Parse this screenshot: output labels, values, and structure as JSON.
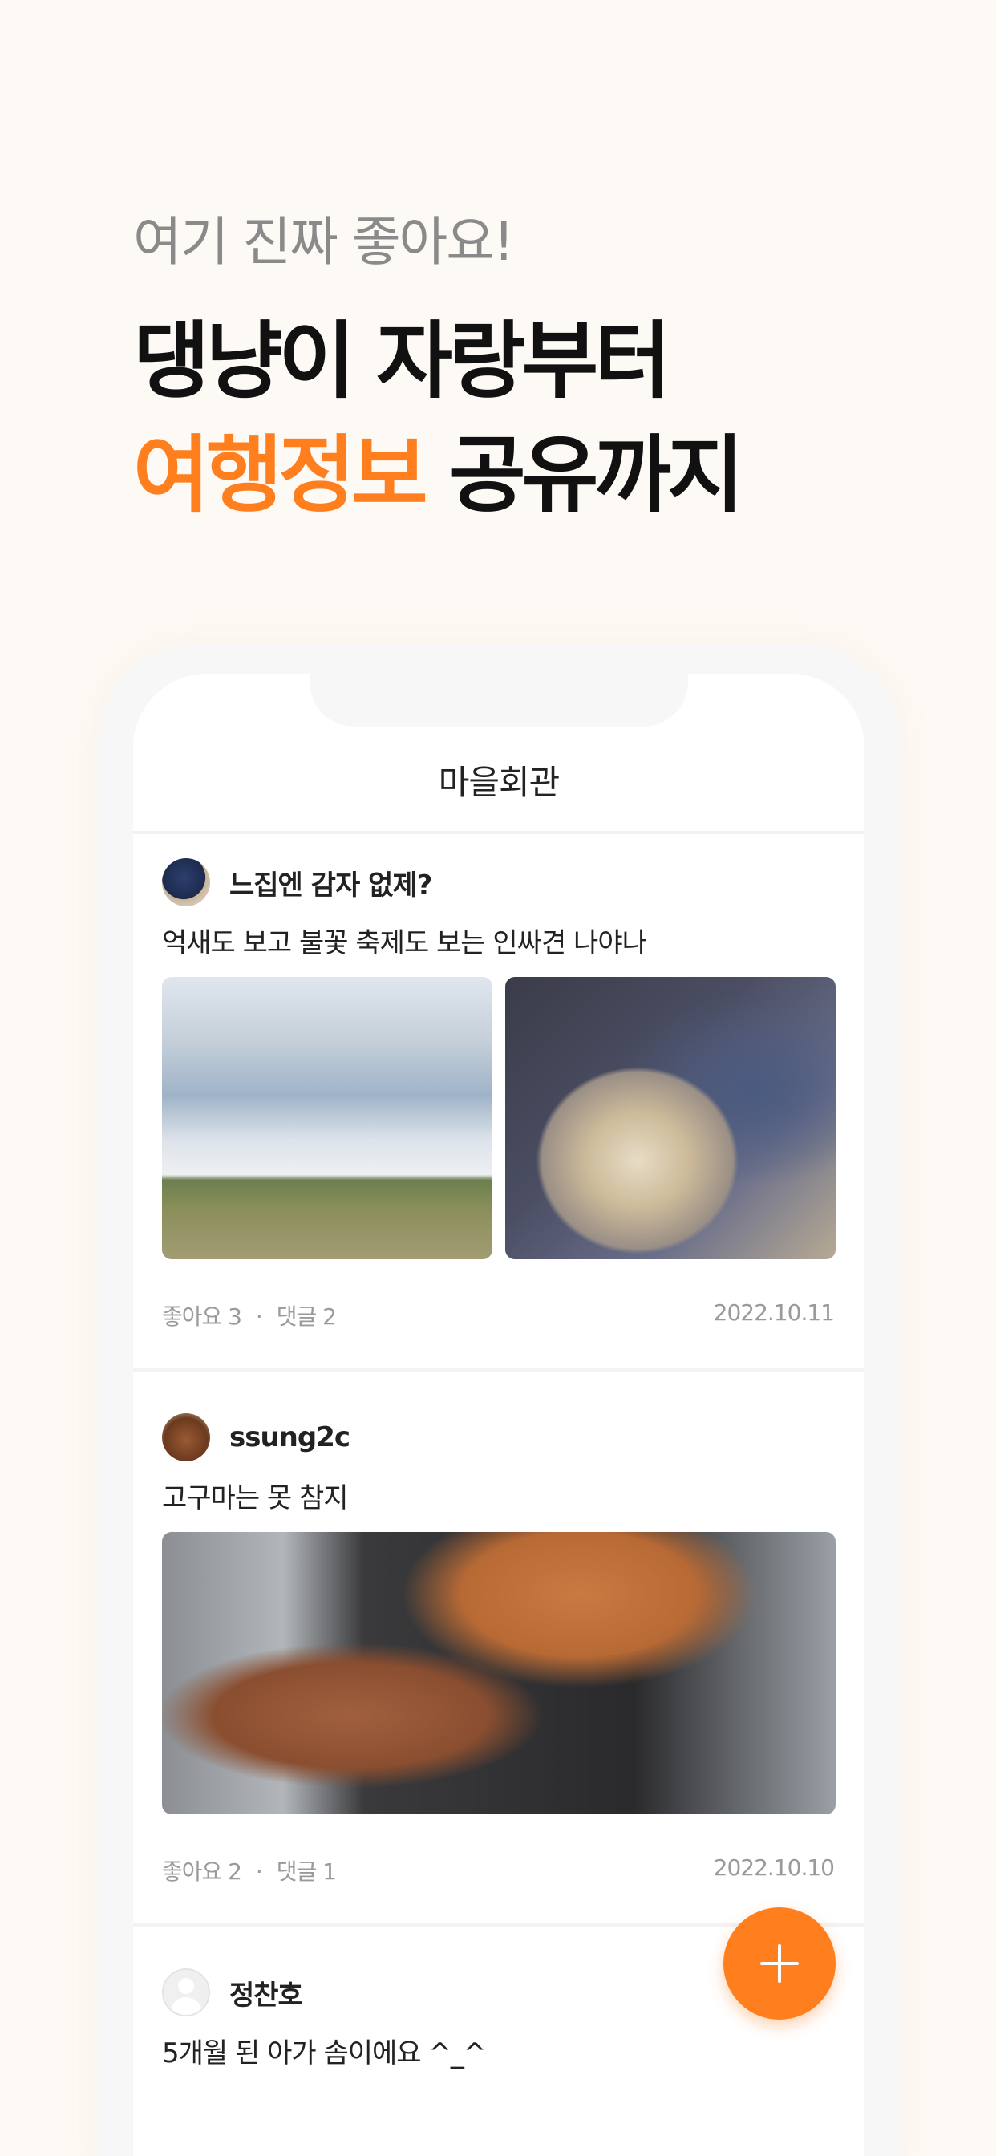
{
  "headline": {
    "subtitle": "여기 진짜 좋아요!",
    "line1": "댕냥이 자랑부터",
    "line2_accent": "여행정보",
    "line2_rest": "공유까지"
  },
  "app": {
    "title": "마을회관"
  },
  "posts": [
    {
      "username": "느집엔 감자 없제?",
      "text": "억새도 보고 불꽃 축제도 보는 인싸견 나야나",
      "likes": "좋아요 3",
      "comments": "댓글 2",
      "separator": "·",
      "date": "2022.10.11"
    },
    {
      "username": "ssung2c",
      "text": "고구마는 못 참지",
      "likes": "좋아요 2",
      "comments": "댓글 1",
      "separator": "·",
      "date": "2022.10.10"
    },
    {
      "username": "정찬호",
      "text": "5개월 된 아가 솜이에요 ^_^"
    }
  ],
  "colors": {
    "accent": "#ff7f1e",
    "background": "#fdf9f4"
  },
  "icons": {
    "fab": "plus-icon"
  }
}
